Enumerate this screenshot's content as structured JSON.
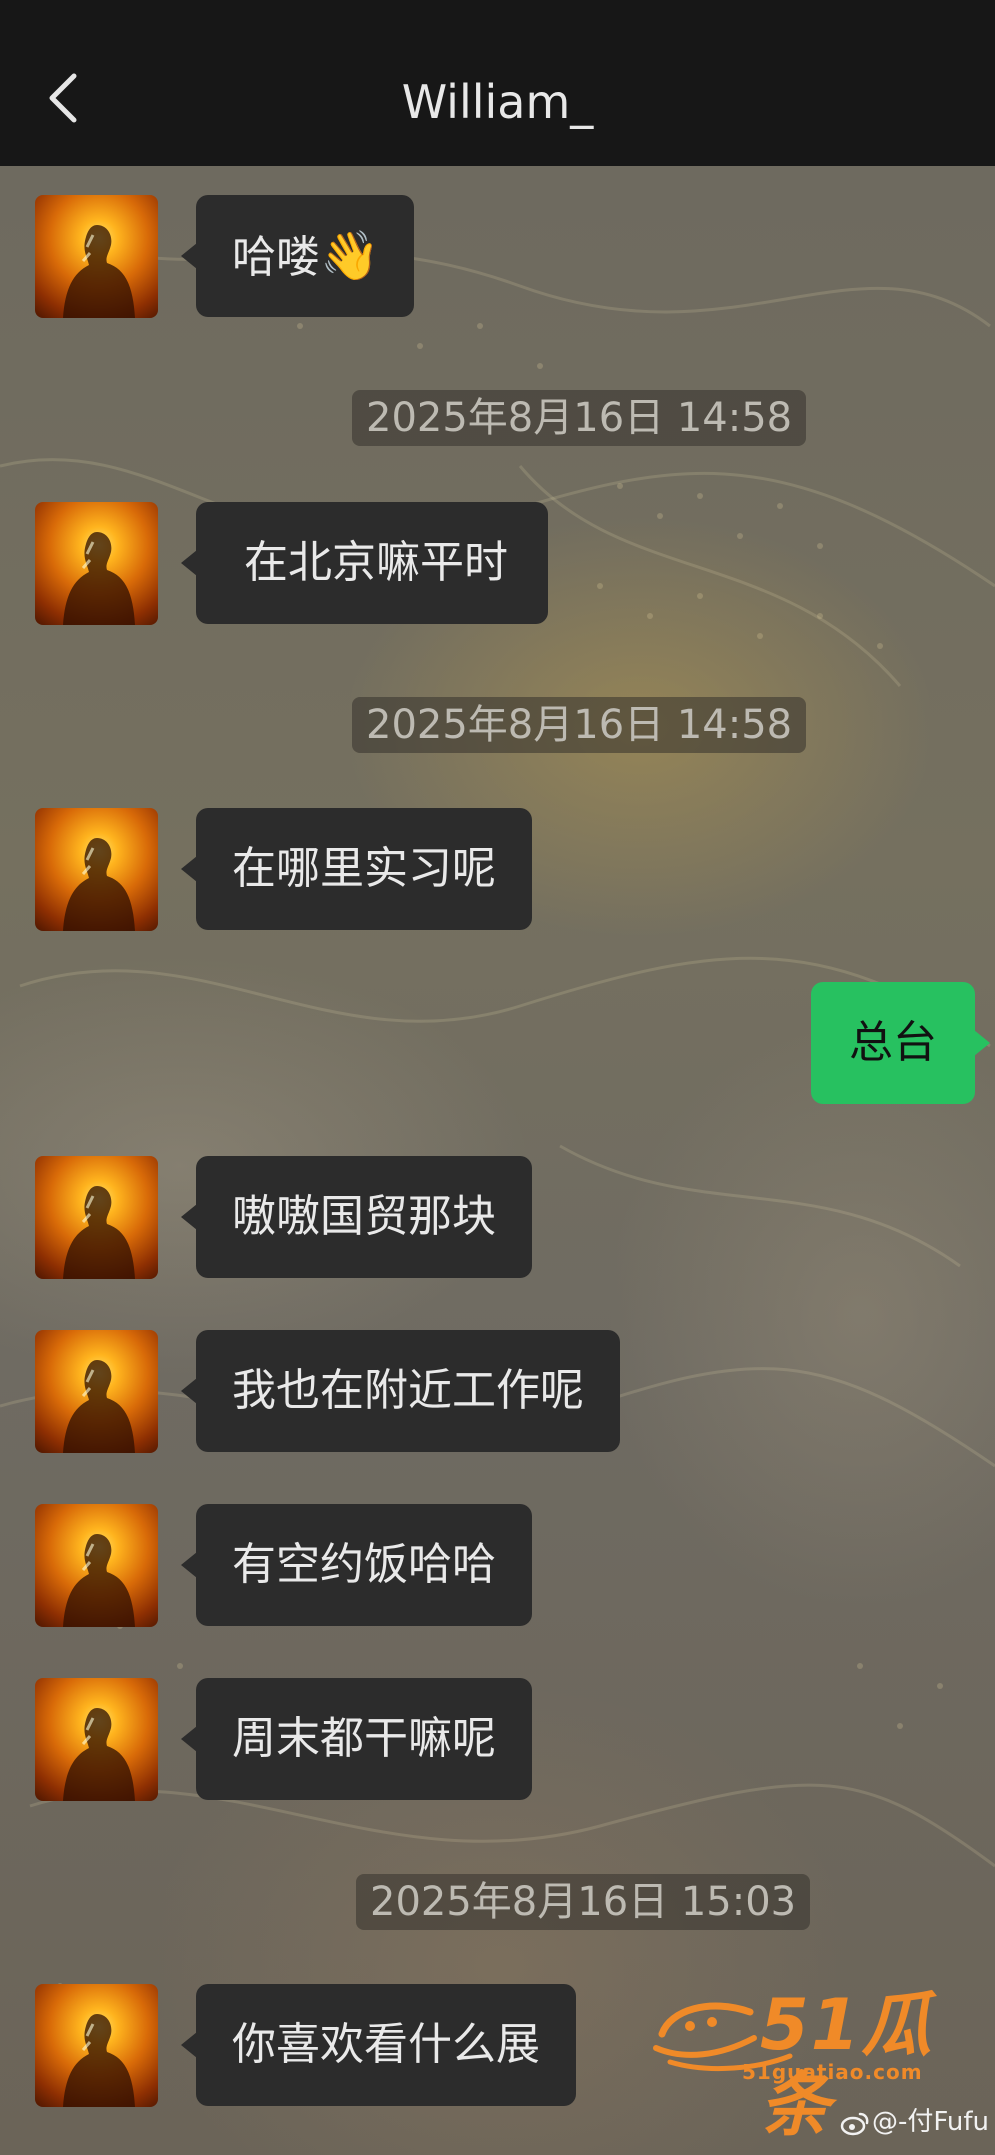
{
  "header": {
    "title": "William_",
    "back_icon": "chevron-left-icon"
  },
  "messages": [
    {
      "type": "incoming",
      "text": "哈喽",
      "emoji": "👋"
    },
    {
      "type": "timestamp",
      "text": "2025年8月16日 14:58"
    },
    {
      "type": "incoming",
      "text": "在北京嘛平时"
    },
    {
      "type": "timestamp",
      "text": "2025年8月16日 14:58"
    },
    {
      "type": "incoming",
      "text": "在哪里实习呢"
    },
    {
      "type": "outgoing",
      "text": "总台"
    },
    {
      "type": "incoming",
      "text": "嗷嗷国贸那块"
    },
    {
      "type": "incoming",
      "text": "我也在附近工作呢"
    },
    {
      "type": "incoming",
      "text": "有空约饭哈哈"
    },
    {
      "type": "incoming",
      "text": "周末都干嘛呢"
    },
    {
      "type": "timestamp",
      "text": "2025年8月16日 15:03"
    },
    {
      "type": "incoming",
      "text": "你喜欢看什么展"
    }
  ],
  "watermark": {
    "brand": "51瓜条",
    "site": "51guatiao.com",
    "weibo_handle": "@-付Fufu"
  },
  "colors": {
    "topbar": "#171717",
    "incoming_bubble": "#2c2c2c",
    "outgoing_bubble": "#27c160",
    "watermark": "#f08a28"
  }
}
